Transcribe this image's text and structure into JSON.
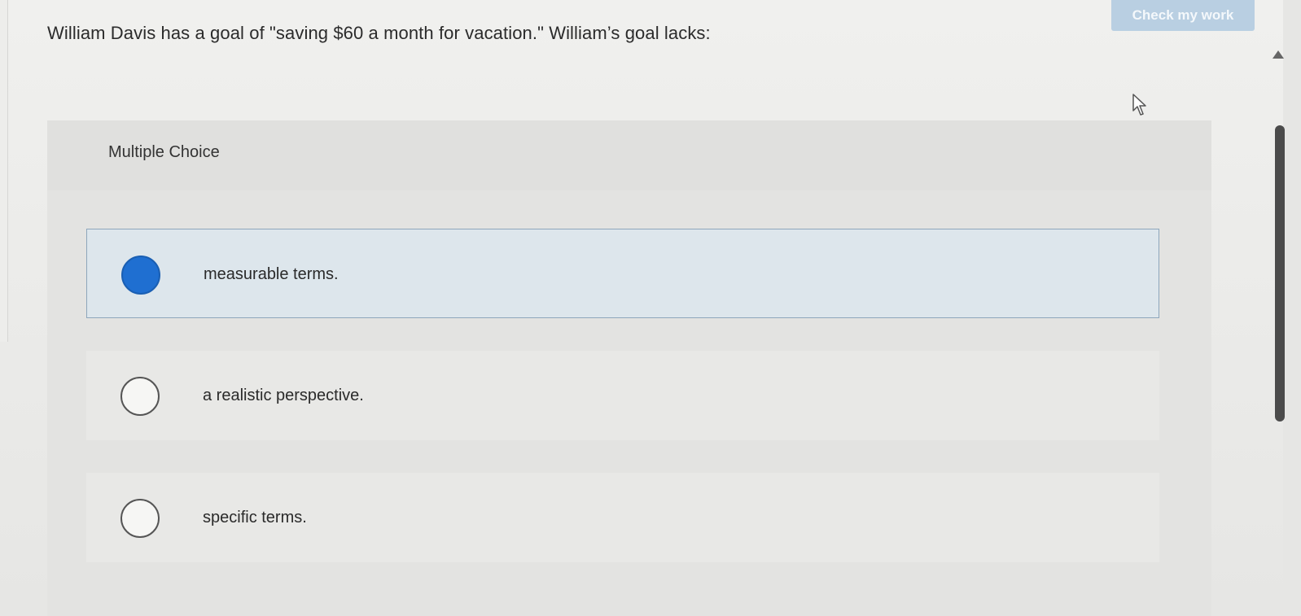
{
  "header": {
    "check_button_label": "Check my work"
  },
  "question": {
    "text": "William Davis has a goal of \"saving $60 a month for vacation.\" William’s goal lacks:"
  },
  "multiple_choice": {
    "label": "Multiple Choice",
    "options": [
      {
        "label": "measurable terms.",
        "selected": true
      },
      {
        "label": "a realistic perspective.",
        "selected": false
      },
      {
        "label": "specific terms.",
        "selected": false
      }
    ]
  },
  "icons": {
    "cursor": "mouse-pointer-icon",
    "scroll_up": "triangle-up-icon"
  },
  "colors": {
    "accent": "#1f6fd1",
    "check_button": "#b9cfe2",
    "selected_option_bg": "#dde6ec",
    "selected_option_border": "#8da6bb"
  }
}
